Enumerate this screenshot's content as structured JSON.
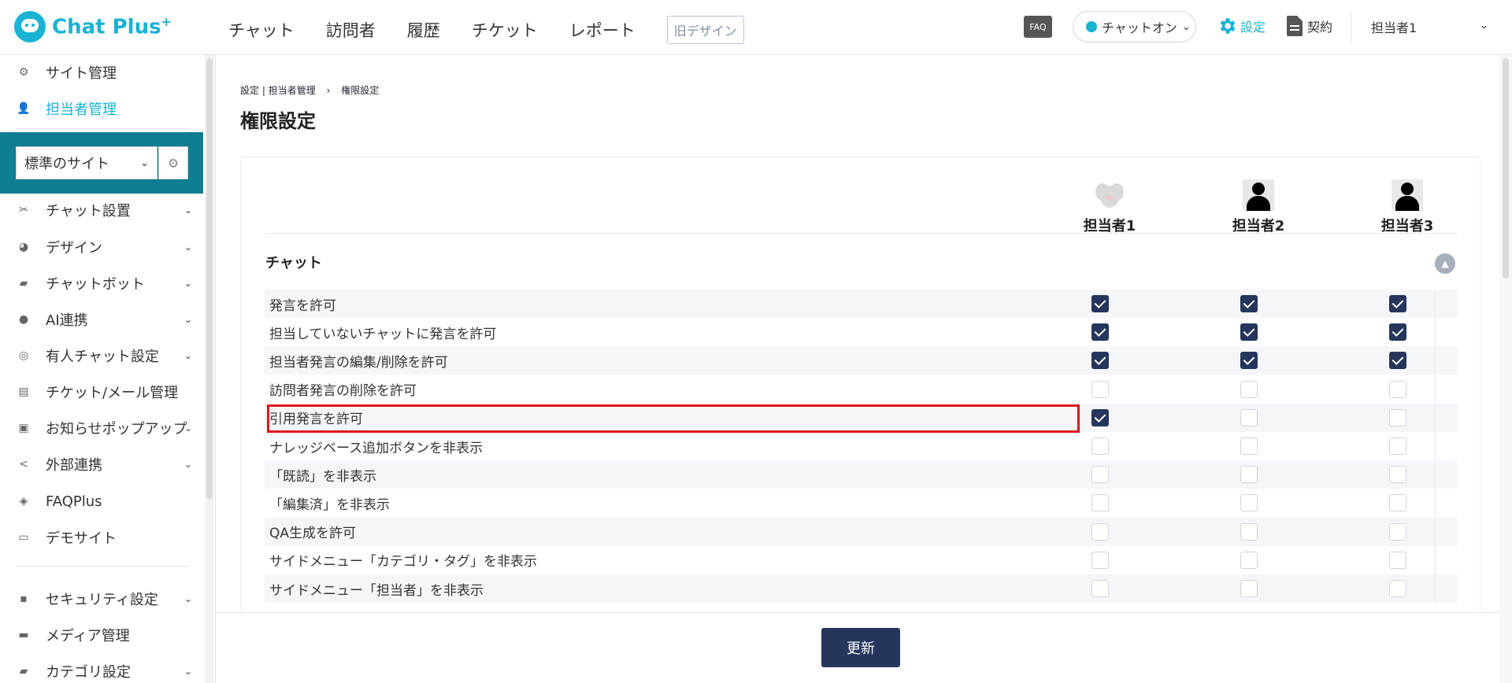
{
  "header": {
    "logo_text": "Chat Plus",
    "logo_plus": "+",
    "nav": [
      "チャット",
      "訪問者",
      "履歴",
      "チケット",
      "レポート"
    ],
    "old_design": "旧デザイン",
    "faq": "FAQ",
    "chat_status": "チャットオン",
    "settings": "設定",
    "contract": "契約",
    "user": "担当者1"
  },
  "sidebar": {
    "top_items": [
      {
        "label": "サイト管理",
        "icon": "gear-icon",
        "active": false
      },
      {
        "label": "担当者管理",
        "icon": "person-gear-icon",
        "active": true
      }
    ],
    "site_select": "標準のサイト",
    "items": [
      {
        "label": "チャット設置",
        "icon": "tools-icon",
        "has_sub": true
      },
      {
        "label": "デザイン",
        "icon": "palette-icon",
        "has_sub": true
      },
      {
        "label": "チャットボット",
        "icon": "chat-bubble-icon",
        "has_sub": true
      },
      {
        "label": "AI連携",
        "icon": "ai-head-icon",
        "has_sub": true
      },
      {
        "label": "有人チャット設定",
        "icon": "headset-icon",
        "has_sub": true
      },
      {
        "label": "チケット/メール管理",
        "icon": "list-icon",
        "has_sub": false
      },
      {
        "label": "お知らせポップアップ",
        "icon": "popup-icon",
        "has_sub": true
      },
      {
        "label": "外部連携",
        "icon": "share-icon",
        "has_sub": true
      },
      {
        "label": "FAQPlus",
        "icon": "faq-shield-icon",
        "has_sub": false
      },
      {
        "label": "デモサイト",
        "icon": "monitor-icon",
        "has_sub": false
      }
    ],
    "bottom_items": [
      {
        "label": "セキュリティ設定",
        "icon": "lock-icon",
        "has_sub": true
      },
      {
        "label": "メディア管理",
        "icon": "image-icon",
        "has_sub": false
      },
      {
        "label": "カテゴリ設定",
        "icon": "folder-icon",
        "has_sub": true
      }
    ]
  },
  "breadcrumb": {
    "part1": "設定",
    "sep": "|",
    "part2": "担当者管理",
    "arrow": "›",
    "part3": "権限設定"
  },
  "page_title": "権限設定",
  "columns": [
    {
      "name": "担当者1",
      "avatar": "mouse"
    },
    {
      "name": "担当者2",
      "avatar": "person"
    },
    {
      "name": "担当者3",
      "avatar": "person"
    }
  ],
  "section": {
    "title": "チャット",
    "rows": [
      {
        "label": "発言を許可",
        "checks": [
          true,
          true,
          true
        ]
      },
      {
        "label": "担当していないチャットに発言を許可",
        "checks": [
          true,
          true,
          true
        ]
      },
      {
        "label": "担当者発言の編集/削除を許可",
        "checks": [
          true,
          true,
          true
        ]
      },
      {
        "label": "訪問者発言の削除を許可",
        "checks": [
          false,
          false,
          false
        ]
      },
      {
        "label": "引用発言を許可",
        "checks": [
          true,
          false,
          false
        ],
        "highlighted": true
      },
      {
        "label": "ナレッジベース追加ボタンを非表示",
        "checks": [
          false,
          false,
          false
        ]
      },
      {
        "label": "「既読」を非表示",
        "checks": [
          false,
          false,
          false
        ]
      },
      {
        "label": "「編集済」を非表示",
        "checks": [
          false,
          false,
          false
        ]
      },
      {
        "label": "QA生成を許可",
        "checks": [
          false,
          false,
          false
        ]
      },
      {
        "label": "サイドメニュー「カテゴリ・タグ」を非表示",
        "checks": [
          false,
          false,
          false
        ]
      },
      {
        "label": "サイドメニュー「担当者」を非表示",
        "checks": [
          false,
          false,
          false
        ]
      }
    ]
  },
  "update_button": "更新",
  "colors": {
    "brand": "#19b3d4",
    "navy": "#25355c",
    "highlight": "#e0161e",
    "site_box": "#0e7f93"
  }
}
